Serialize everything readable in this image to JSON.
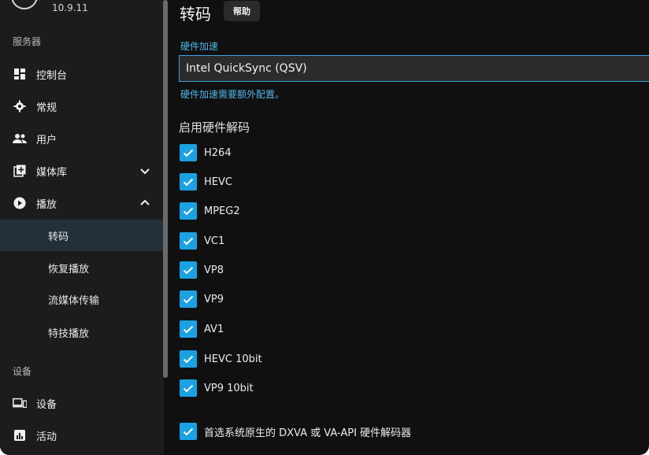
{
  "sidebar": {
    "version": "10.9.11",
    "section_server": "服务器",
    "items": [
      {
        "label": "控制台",
        "icon": "dashboard-icon"
      },
      {
        "label": "常规",
        "icon": "gear-icon"
      },
      {
        "label": "用户",
        "icon": "users-icon"
      },
      {
        "label": "媒体库",
        "icon": "library-add-icon"
      },
      {
        "label": "播放",
        "icon": "play-circle-icon"
      }
    ],
    "playback_sub": [
      "转码",
      "恢复播放",
      "流媒体传输",
      "特技播放"
    ],
    "section_devices": "设备",
    "device_items": [
      {
        "label": "设备",
        "icon": "devices-icon"
      },
      {
        "label": "活动",
        "icon": "activity-icon"
      }
    ]
  },
  "main": {
    "title": "转码",
    "help_label": "帮助",
    "hw_accel": {
      "label": "硬件加速",
      "value": "Intel QuickSync (QSV)",
      "help": "硬件加速需要额外配置。"
    },
    "decode_title": "启用硬件解码",
    "codecs": [
      "H264",
      "HEVC",
      "MPEG2",
      "VC1",
      "VP8",
      "VP9",
      "AV1",
      "HEVC 10bit",
      "VP9 10bit"
    ],
    "prefer_native": "首选系统原生的 DXVA 或 VA-API 硬件解码器"
  },
  "colors": {
    "accent": "#1aa2e3",
    "active_bg": "#233039",
    "sidebar_bg": "#1c1c1c",
    "main_bg": "#101010"
  }
}
